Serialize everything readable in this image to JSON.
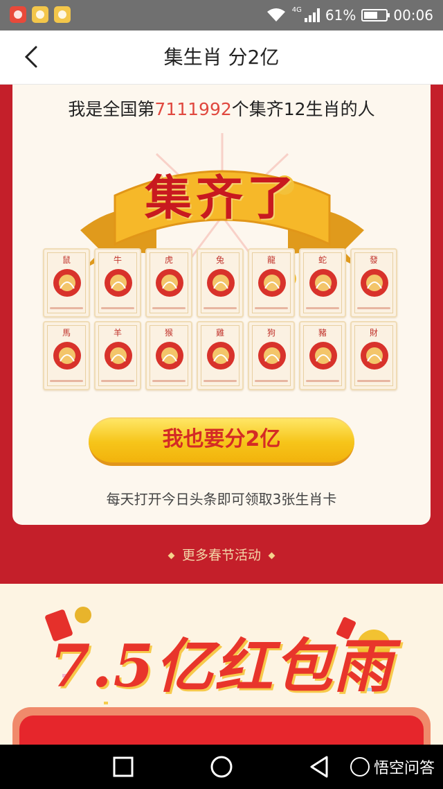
{
  "status_bar": {
    "network": "4G",
    "battery": "61%",
    "battery_level": 0.61,
    "time": "00:06",
    "apps": [
      "app-icon-1",
      "app-icon-2",
      "app-icon-3"
    ]
  },
  "nav": {
    "title": "集生肖 分2亿",
    "back_icon": "chevron-left-icon"
  },
  "card": {
    "headline_prefix": "我是全国第",
    "headline_number": "7111992",
    "headline_suffix": "个集齐12生肖的人",
    "banner_text": "集齐了",
    "zodiac": [
      {
        "label": "鼠",
        "icon": "rat-icon"
      },
      {
        "label": "牛",
        "icon": "ox-icon"
      },
      {
        "label": "虎",
        "icon": "tiger-icon"
      },
      {
        "label": "兔",
        "icon": "rabbit-icon"
      },
      {
        "label": "龍",
        "icon": "dragon-icon"
      },
      {
        "label": "蛇",
        "icon": "snake-icon"
      },
      {
        "label": "發",
        "icon": "fortune-icon"
      },
      {
        "label": "馬",
        "icon": "horse-icon"
      },
      {
        "label": "羊",
        "icon": "goat-icon"
      },
      {
        "label": "猴",
        "icon": "monkey-icon"
      },
      {
        "label": "雞",
        "icon": "rooster-icon"
      },
      {
        "label": "狗",
        "icon": "dog-icon"
      },
      {
        "label": "豬",
        "icon": "pig-icon"
      },
      {
        "label": "財",
        "icon": "wealth-icon"
      }
    ],
    "cta_label": "我也要分2亿",
    "hint": "每天打开今日头条即可领取3张生肖卡"
  },
  "more_link": "更多春节活动",
  "lower": {
    "title": "7.5亿红包雨"
  },
  "watermark": {
    "text": "悟空问答"
  },
  "colors": {
    "primary_red": "#c41f2a",
    "accent_red": "#e0483f",
    "gold": "#f6c51a",
    "cream": "#fdf7ee"
  }
}
